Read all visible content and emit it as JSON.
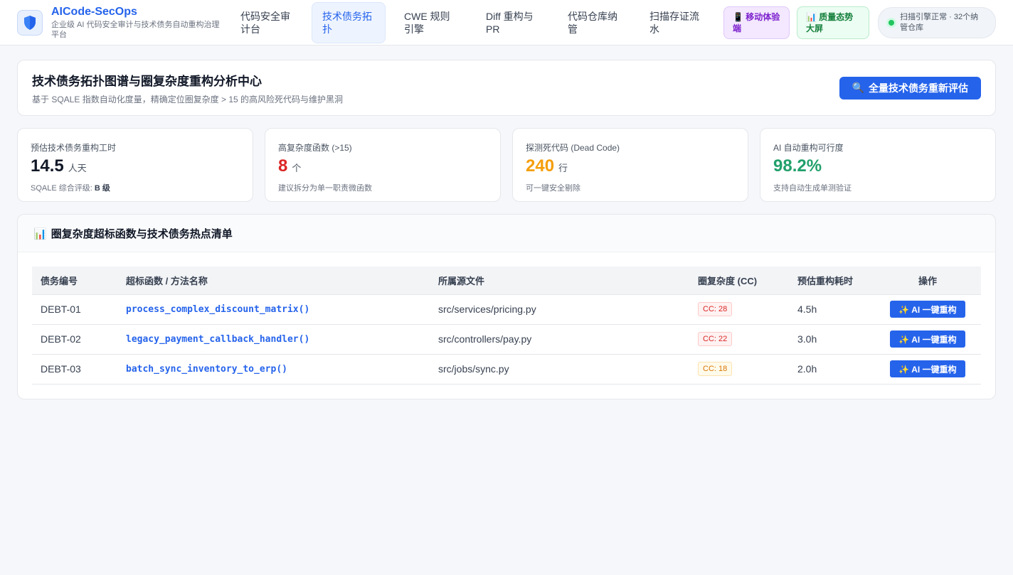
{
  "brand": {
    "name": "AICode-SecOps",
    "subtitle": "企业级 AI 代码安全审计与技术债务自动重构治理平台"
  },
  "nav": {
    "items": [
      {
        "label": "代码安全审计台"
      },
      {
        "label": "技术债务拓扑"
      },
      {
        "label": "CWE 规则引擎"
      },
      {
        "label": "Diff 重构与 PR"
      },
      {
        "label": "代码仓库纳管"
      },
      {
        "label": "扫描存证流水"
      }
    ],
    "active_index": 1,
    "mobile_label": "📱 移动体验端",
    "quality_label": "📊 质量态势大屏",
    "status_text": "扫描引擎正常 · 32个纳管仓库"
  },
  "hero": {
    "title": "技术债务拓扑图谱与圈复杂度重构分析中心",
    "subtitle": "基于 SQALE 指数自动化度量，精确定位圈复杂度 > 15 的高风险死代码与维护黑洞",
    "button_icon": "🔍",
    "button_label": "全量技术债务重新评估"
  },
  "stats": [
    {
      "label": "预估技术债务重构工时",
      "value": "14.5",
      "unit": "人天",
      "note_prefix": "SQALE 综合评级: ",
      "note_bold": "B 级",
      "color": "#111827"
    },
    {
      "label": "高复杂度函数 (>15)",
      "value": "8",
      "unit": "个",
      "note_prefix": "建议拆分为单一职责微函数",
      "note_bold": "",
      "color": "#dc2626"
    },
    {
      "label": "探测死代码 (Dead Code)",
      "value": "240",
      "unit": "行",
      "note_prefix": "可一键安全剔除",
      "note_bold": "",
      "color": "#f59e0b"
    },
    {
      "label": "AI 自动重构可行度",
      "value": "98.2%",
      "unit": "",
      "note_prefix": "支持自动生成单测验证",
      "note_bold": "",
      "color": "#22a06b"
    }
  ],
  "debt_table": {
    "icon": "📊",
    "title": "圈复杂度超标函数与技术债务热点清单",
    "columns": [
      "债务编号",
      "超标函数 / 方法名称",
      "所属源文件",
      "圈复杂度 (CC)",
      "预估重构耗时",
      "操作"
    ],
    "rows": [
      {
        "id": "DEBT-01",
        "fn": "process_complex_discount_matrix()",
        "file": "src/services/pricing.py",
        "cc": "CC: 28",
        "cc_level": "red",
        "time": "4.5h",
        "action": "✨ AI 一键重构"
      },
      {
        "id": "DEBT-02",
        "fn": "legacy_payment_callback_handler()",
        "file": "src/controllers/pay.py",
        "cc": "CC: 22",
        "cc_level": "red",
        "time": "3.0h",
        "action": "✨ AI 一键重构"
      },
      {
        "id": "DEBT-03",
        "fn": "batch_sync_inventory_to_erp()",
        "file": "src/jobs/sync.py",
        "cc": "CC: 18",
        "cc_level": "amber",
        "time": "2.0h",
        "action": "✨ AI 一键重构"
      }
    ]
  }
}
